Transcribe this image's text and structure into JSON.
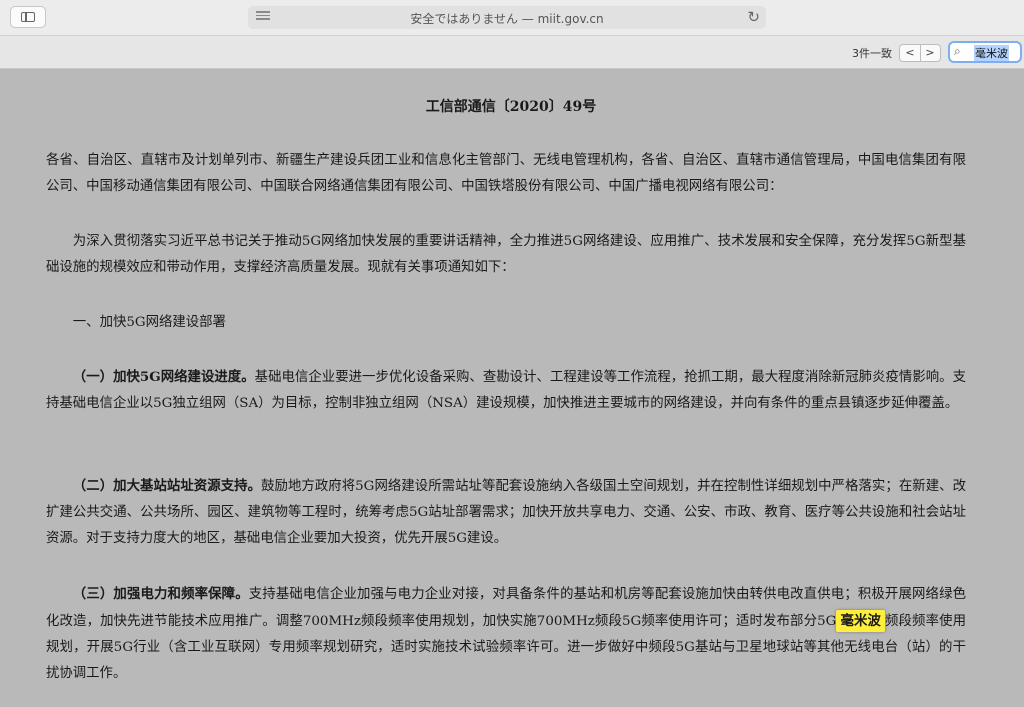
{
  "browser": {
    "url_text": "安全ではありません — miit.gov.cn"
  },
  "find": {
    "match_count": "3件一致",
    "prev": "<",
    "next": ">",
    "query": "毫米波"
  },
  "document": {
    "title": "工信部通信〔2020〕49号",
    "addressees": "各省、自治区、直辖市及计划单列市、新疆生产建设兵团工业和信息化主管部门、无线电管理机构，各省、自治区、直辖市通信管理局，中国电信集团有限公司、中国移动通信集团有限公司、中国联合网络通信集团有限公司、中国铁塔股份有限公司、中国广播电视网络有限公司：",
    "intro": "为深入贯彻落实习近平总书记关于推动5G网络加快发展的重要讲话精神，全力推进5G网络建设、应用推广、技术发展和安全保障，充分发挥5G新型基础设施的规模效应和带动作用，支撑经济高质量发展。现就有关事项通知如下：",
    "section1_heading": "一、加快5G网络建设部署",
    "item1_title": "（一）加快5G网络建设进度。",
    "item1_body": "基础电信企业要进一步优化设备采购、查勘设计、工程建设等工作流程，抢抓工期，最大程度消除新冠肺炎疫情影响。支持基础电信企业以5G独立组网（SA）为目标，控制非独立组网（NSA）建设规模，加快推进主要城市的网络建设，并向有条件的重点县镇逐步延伸覆盖。",
    "item2_title": "（二）加大基站站址资源支持。",
    "item2_body": "鼓励地方政府将5G网络建设所需站址等配套设施纳入各级国土空间规划，并在控制性详细规划中严格落实；在新建、改扩建公共交通、公共场所、园区、建筑物等工程时，统筹考虑5G站址部署需求；加快开放共享电力、交通、公安、市政、教育、医疗等公共设施和社会站址资源。对于支持力度大的地区，基础电信企业要加大投资，优先开展5G建设。",
    "item3_title": "（三）加强电力和频率保障。",
    "item3_body_a": "支持基础电信企业加强与电力企业对接，对具备条件的基站和机房等配套设施加快由转供电改直供电；积极开展网络绿色化改造，加快先进节能技术应用推广。调整700MHz频段频率使用规划，加快实施700MHz频段5G频率使用许可；适时发布部分5G",
    "item3_highlight": "毫米波",
    "item3_body_b": "频段频率使用规划，开展5G行业（含工业互联网）专用频率规划研究，适时实施技术试验频率许可。进一步做好中频段5G基站与卫星地球站等其他无线电台（站）的干扰协调工作。"
  }
}
